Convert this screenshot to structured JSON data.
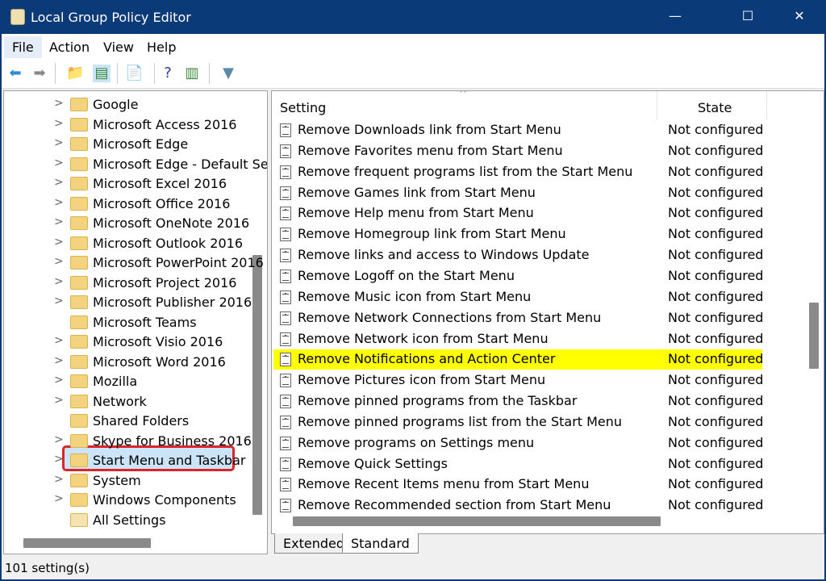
{
  "window": {
    "title": "Local Group Policy Editor",
    "minimize": "—",
    "maximize": "☐",
    "close": "✕"
  },
  "menu": [
    "File",
    "Action",
    "View",
    "Help"
  ],
  "toolbar": [
    {
      "icon": "back-arrow-icon",
      "glyph": "⬅",
      "color": "#2a8ad8"
    },
    {
      "icon": "forward-arrow-icon",
      "glyph": "➡",
      "color": "#888888"
    },
    {
      "icon": "up-folder-icon",
      "glyph": "📁",
      "color": "#d9b451"
    },
    {
      "icon": "show-hide-tree-icon",
      "glyph": "▤",
      "color": "#3a8a3a"
    },
    {
      "icon": "export-list-icon",
      "glyph": "📄",
      "color": "#3a8a3a"
    },
    {
      "icon": "help-icon",
      "glyph": "?",
      "color": "#2a3aa8"
    },
    {
      "icon": "show-hide-action-pane-icon",
      "glyph": "▥",
      "color": "#3a8a3a"
    },
    {
      "icon": "filter-icon",
      "glyph": "▼",
      "color": "#5a8aa8"
    }
  ],
  "tree": [
    {
      "label": "Google",
      "chevron": true
    },
    {
      "label": "Microsoft Access 2016",
      "chevron": true
    },
    {
      "label": "Microsoft Edge",
      "chevron": true
    },
    {
      "label": "Microsoft Edge - Default Se",
      "chevron": true
    },
    {
      "label": "Microsoft Excel 2016",
      "chevron": true
    },
    {
      "label": "Microsoft Office 2016",
      "chevron": true
    },
    {
      "label": "Microsoft OneNote 2016",
      "chevron": true
    },
    {
      "label": "Microsoft Outlook 2016",
      "chevron": true
    },
    {
      "label": "Microsoft PowerPoint 2016",
      "chevron": true
    },
    {
      "label": "Microsoft Project 2016",
      "chevron": true
    },
    {
      "label": "Microsoft Publisher 2016",
      "chevron": true
    },
    {
      "label": "Microsoft Teams",
      "chevron": false
    },
    {
      "label": "Microsoft Visio 2016",
      "chevron": true
    },
    {
      "label": "Microsoft Word 2016",
      "chevron": true
    },
    {
      "label": "Mozilla",
      "chevron": true
    },
    {
      "label": "Network",
      "chevron": true
    },
    {
      "label": "Shared Folders",
      "chevron": false
    },
    {
      "label": "Skype for Business 2016",
      "chevron": true
    },
    {
      "label": "Start Menu and Taskbar",
      "chevron": true,
      "selected": true
    },
    {
      "label": "System",
      "chevron": true
    },
    {
      "label": "Windows Components",
      "chevron": true
    },
    {
      "label": "All Settings",
      "chevron": false,
      "icon": "all-settings-icon"
    }
  ],
  "list": {
    "headers": {
      "setting": "Setting",
      "state": "State"
    },
    "rows": [
      {
        "name": "Remove Downloads link from Start Menu",
        "state": "Not configured"
      },
      {
        "name": "Remove Favorites menu from Start Menu",
        "state": "Not configured"
      },
      {
        "name": "Remove frequent programs list from the Start Menu",
        "state": "Not configured"
      },
      {
        "name": "Remove Games link from Start Menu",
        "state": "Not configured"
      },
      {
        "name": "Remove Help menu from Start Menu",
        "state": "Not configured"
      },
      {
        "name": "Remove Homegroup link from Start Menu",
        "state": "Not configured"
      },
      {
        "name": "Remove links and access to Windows Update",
        "state": "Not configured"
      },
      {
        "name": "Remove Logoff on the Start Menu",
        "state": "Not configured"
      },
      {
        "name": "Remove Music icon from Start Menu",
        "state": "Not configured"
      },
      {
        "name": "Remove Network Connections from Start Menu",
        "state": "Not configured"
      },
      {
        "name": "Remove Network icon from Start Menu",
        "state": "Not configured"
      },
      {
        "name": "Remove Notifications and Action Center",
        "state": "Not configured",
        "highlighted": true
      },
      {
        "name": "Remove Pictures icon from Start Menu",
        "state": "Not configured"
      },
      {
        "name": "Remove pinned programs from the Taskbar",
        "state": "Not configured"
      },
      {
        "name": "Remove pinned programs list from the Start Menu",
        "state": "Not configured"
      },
      {
        "name": "Remove programs on Settings menu",
        "state": "Not configured"
      },
      {
        "name": "Remove Quick Settings",
        "state": "Not configured"
      },
      {
        "name": "Remove Recent Items menu from Start Menu",
        "state": "Not configured"
      },
      {
        "name": "Remove Recommended section from Start Menu",
        "state": "Not configured"
      }
    ]
  },
  "tabs": [
    "Extended",
    "Standard"
  ],
  "status": "101 setting(s)",
  "colors": {
    "titlebar": "#0b3a78",
    "highlight": "#ffff00",
    "selection_outline": "#d9242a"
  }
}
